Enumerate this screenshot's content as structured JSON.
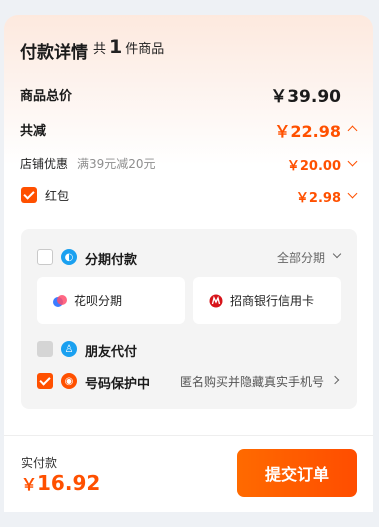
{
  "header": {
    "title": "付款详情",
    "count_prefix": "共",
    "count": "1",
    "count_suffix": "件商品"
  },
  "summary": {
    "total_label": "商品总价",
    "total_value": "￥39.90",
    "discount_label": "共减",
    "discount_value": "￥22.98",
    "store_label": "店铺优惠",
    "store_desc": "满39元减20元",
    "store_value": "￥20.00",
    "redpacket_label": "红包",
    "redpacket_value": "￥2.98",
    "redpacket_checked": true
  },
  "installment": {
    "label": "分期付款",
    "right_label": "全部分期",
    "checked": false,
    "options": [
      {
        "label": "花呗分期",
        "icon": "huabei-icon"
      },
      {
        "label": "招商银行信用卡",
        "icon": "cmb-bank-icon"
      }
    ]
  },
  "friend_pay": {
    "label": "朋友代付",
    "checked": false,
    "disabled": true
  },
  "number_protect": {
    "label": "号码保护中",
    "desc": "匿名购买并隐藏真实手机号",
    "checked": true
  },
  "footer": {
    "pay_label": "实付款",
    "currency": "￥",
    "pay_amount": "16.92",
    "submit_label": "提交订单"
  },
  "colors": {
    "accent": "#ff5000",
    "background": "#eef1f5"
  }
}
